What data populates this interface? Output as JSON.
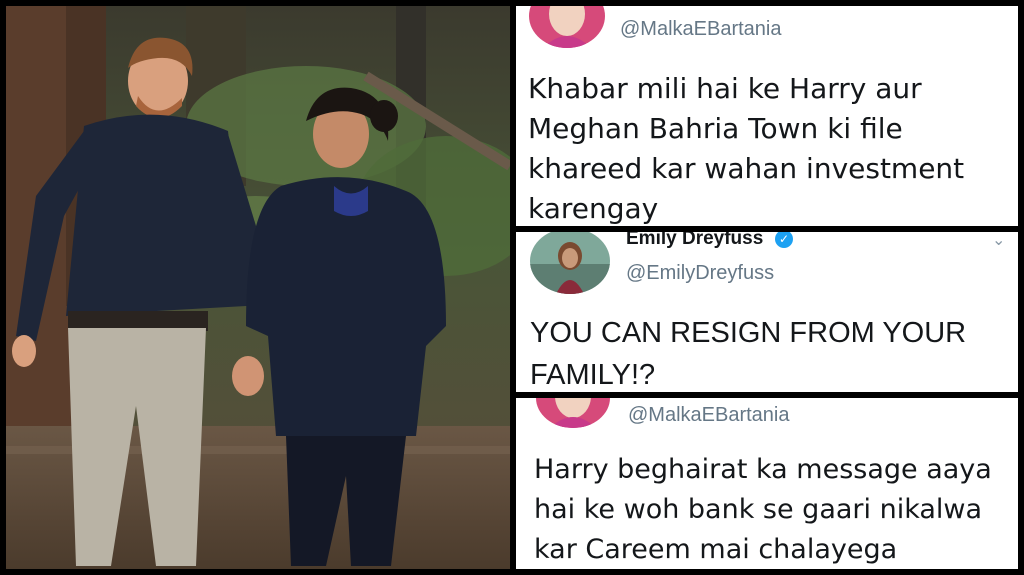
{
  "photo": {
    "description_icon": "couple-walking-forest-photo"
  },
  "tweets": [
    {
      "handle": "@MalkaEBartania",
      "text": "Khabar mili hai ke Harry aur Meghan Bahria Town ki file khareed kar wahan investment karengay"
    },
    {
      "name": "Emily Dreyfuss",
      "handle": "@EmilyDreyfuss",
      "text": "YOU CAN RESIGN FROM YOUR FAMILY!?"
    },
    {
      "handle": "@MalkaEBartania",
      "text": "Harry beghairat ka message aaya hai ke woh bank se gaari nikalwa kar Careem mai chalayega"
    }
  ],
  "colors": {
    "handle": "#657786",
    "text": "#14171a",
    "verified": "#1da1f2"
  }
}
